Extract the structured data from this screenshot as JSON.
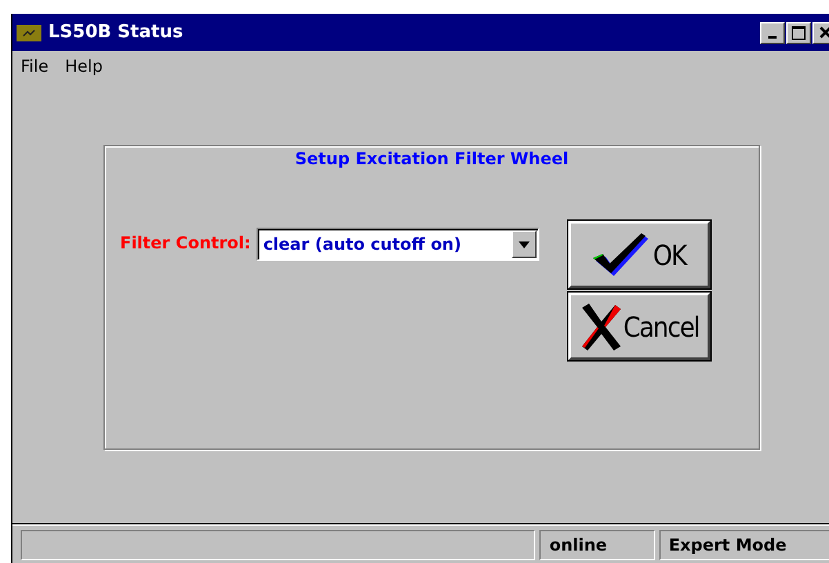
{
  "window": {
    "title": "LS50B Status"
  },
  "menu": [
    "File",
    "Help"
  ],
  "group": {
    "title": "Setup Excitation Filter Wheel"
  },
  "filter_control": {
    "label": "Filter Control:",
    "value": "clear (auto cutoff on)"
  },
  "buttons": [
    {
      "kind": "ok",
      "label": "OK"
    },
    {
      "kind": "cancel",
      "label": "Cancel"
    }
  ],
  "status_bar": [
    "online",
    "Expert Mode"
  ]
}
